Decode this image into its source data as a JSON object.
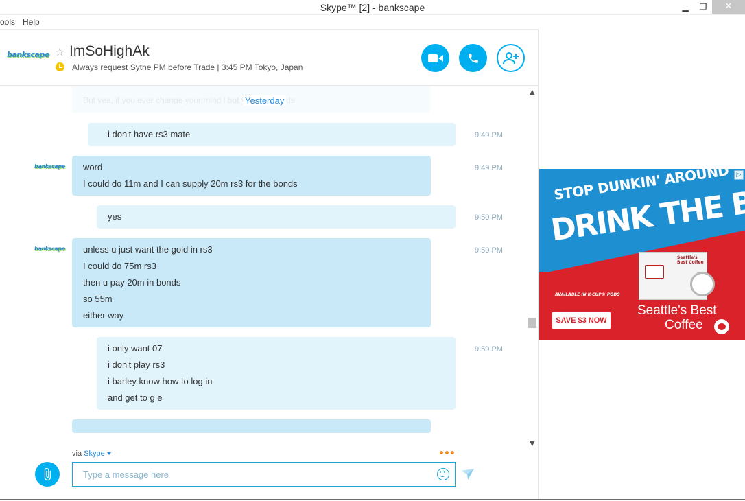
{
  "window": {
    "title": "Skype™ [2] - bankscape",
    "minimize": "▁",
    "maximize": "❐",
    "close": "✕"
  },
  "menu": {
    "items": [
      "ools",
      "Help"
    ]
  },
  "header": {
    "contact_name": "ImSoHighAk",
    "avatar_text": "bankscape",
    "mood": "Always request Sythe PM before Trade  |  3:45 PM Tokyo, Japan"
  },
  "conversation": {
    "ghost_text": "But yea, if you ever change your mind l         but you pay bonds",
    "day_separator": "Yesterday",
    "messages": [
      {
        "direction": "out",
        "time": "9:49 PM",
        "lines": [
          "i don't have rs3 mate"
        ]
      },
      {
        "direction": "in",
        "time": "9:49 PM",
        "lines": [
          "word",
          "I could do 11m and I can supply 20m rs3 for the bonds"
        ]
      },
      {
        "direction": "out",
        "time": "9:50 PM",
        "lines": [
          "yes"
        ]
      },
      {
        "direction": "in",
        "time": "9:50 PM",
        "lines": [
          "unless u just want the gold in rs3",
          "I could do 75m rs3",
          "then u pay 20m in bonds",
          "so 55m",
          "either way"
        ]
      },
      {
        "direction": "out",
        "time": "9:59 PM",
        "lines": [
          "i only want 07",
          "i don't play rs3",
          "i barley know how to log in",
          "and get to g e"
        ]
      }
    ]
  },
  "composer": {
    "via_label": "via",
    "via_service": "Skype",
    "typing_indicator": "•••",
    "placeholder": "Type a message here"
  },
  "ad": {
    "headline1": "STOP DUNKIN' AROUND",
    "headline2": "DRINK THE BEST",
    "small_text": "AVAILABLE IN K-CUP® PODS",
    "product_label": "Seattle's Best Coffee",
    "cta": "SAVE $3 NOW",
    "brand1": "Seattle's Best",
    "brand2": "Coffee",
    "colors": {
      "red": "#d9222a",
      "blue": "#1e8fd1"
    }
  },
  "colors": {
    "accent": "#00aff0",
    "bubble_in": "#c9e9f8",
    "bubble_out": "#e1f3fb"
  }
}
